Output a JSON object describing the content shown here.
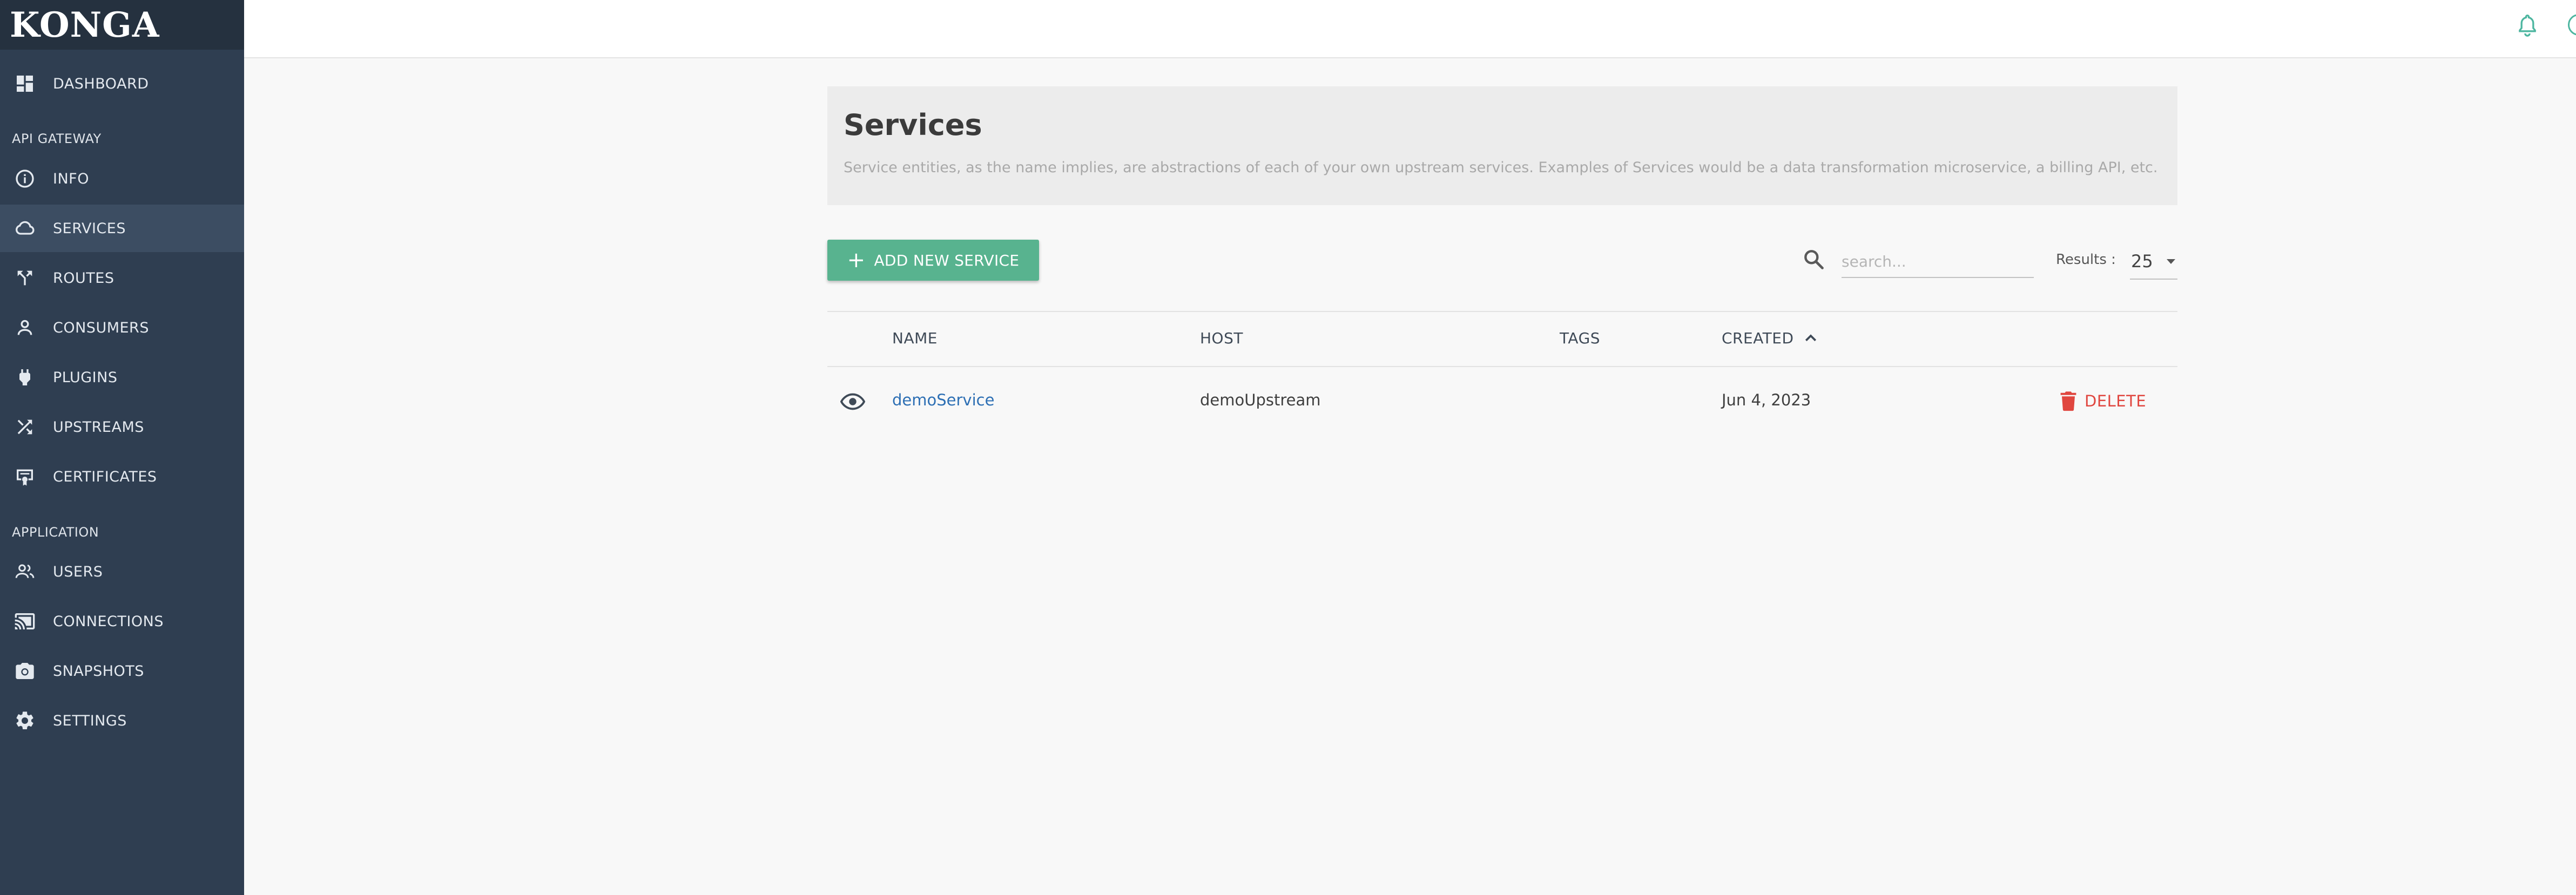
{
  "app": {
    "logo": "KONGA"
  },
  "sidebar": {
    "items": [
      {
        "label": "DASHBOARD",
        "icon": "dashboard-icon"
      },
      {
        "label": "INFO",
        "icon": "info-icon"
      },
      {
        "label": "SERVICES",
        "icon": "cloud-icon",
        "active": true
      },
      {
        "label": "ROUTES",
        "icon": "routes-icon"
      },
      {
        "label": "CONSUMERS",
        "icon": "person-icon"
      },
      {
        "label": "PLUGINS",
        "icon": "plug-icon"
      },
      {
        "label": "UPSTREAMS",
        "icon": "shuffle-icon"
      },
      {
        "label": "CERTIFICATES",
        "icon": "certificate-icon"
      },
      {
        "label": "USERS",
        "icon": "users-icon"
      },
      {
        "label": "CONNECTIONS",
        "icon": "cast-icon"
      },
      {
        "label": "SNAPSHOTS",
        "icon": "camera-icon"
      },
      {
        "label": "SETTINGS",
        "icon": "gear-icon"
      }
    ],
    "sections": {
      "api_gateway": "API GATEWAY",
      "application": "APPLICATION"
    }
  },
  "header": {
    "title": "Services",
    "description": "Service entities, as the name implies, are abstractions of each of your own upstream services. Examples of Services would be a data transformation microservice, a billing API, etc."
  },
  "toolbar": {
    "add_label": "ADD NEW SERVICE",
    "search_placeholder": "search...",
    "results_label": "Results :",
    "results_value": "25"
  },
  "table": {
    "columns": [
      "NAME",
      "HOST",
      "TAGS",
      "CREATED"
    ],
    "sort": {
      "column": "CREATED",
      "direction": "ascending"
    },
    "rows": [
      {
        "name": "demoService",
        "host": "demoUpstream",
        "tags": "",
        "created": "Jun 4, 2023",
        "action": "DELETE"
      }
    ]
  },
  "colors": {
    "sidebar_bg": "#2f3e51",
    "accent_green": "#58b38f",
    "link_blue": "#2d6fb4",
    "danger_red": "#e0463f"
  }
}
